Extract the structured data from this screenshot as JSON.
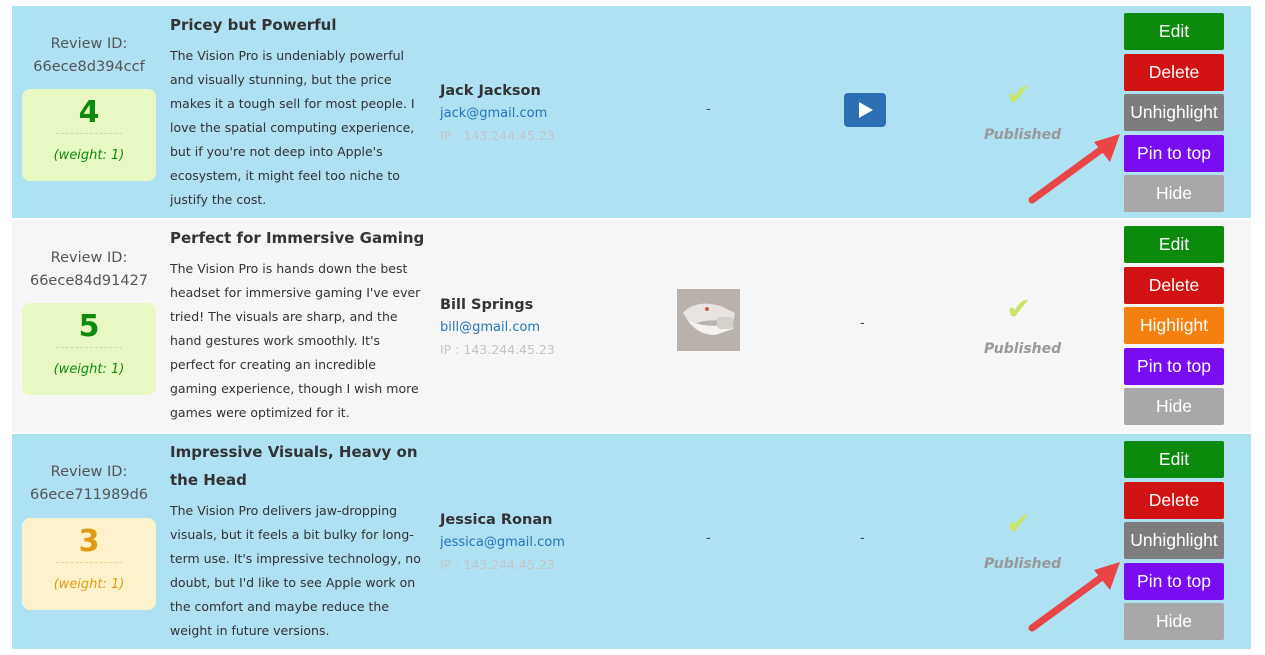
{
  "colors": {
    "highlight_row": "#aee1f2",
    "plain_row": "#f6f6f6",
    "edit": "#0b8a0b",
    "delete": "#d01212",
    "unhighlight": "#7d7d7d",
    "highlight": "#f5800f",
    "pin": "#7a0cf2",
    "hide": "#a8a8a8",
    "annotation_arrow": "#e94545"
  },
  "reviews": [
    {
      "id_label": "Review ID:",
      "id": "66ece8d394ccf",
      "score": "4",
      "weight": "(weight: 1)",
      "title": "Pricey but Powerful",
      "body": "The Vision Pro is undeniably powerful and visually stunning, but the price makes it a tough sell for most people. I love the spatial computing experience, but if you're not deep into Apple's ecosystem, it might feel too niche to justify the cost.",
      "author": "Jack Jackson",
      "email": "jack@gmail.com",
      "ip": "IP : 143.244.45.23",
      "media_placeholder": "-",
      "video_icon": "play-icon",
      "status_icon": "checkmark-icon",
      "status": "Published",
      "buttons": [
        "Edit",
        "Delete",
        "Unhighlight",
        "Pin to top",
        "Hide"
      ]
    },
    {
      "id_label": "Review ID:",
      "id": "66ece84d91427",
      "score": "5",
      "weight": "(weight: 1)",
      "title": "Perfect for Immersive Gaming",
      "body": "The Vision Pro is hands down the best headset for immersive gaming I've ever tried! The visuals are sharp, and the hand gestures work smoothly. It's perfect for creating an incredible gaming experience, though I wish more games were optimized for it.",
      "author": "Bill Springs",
      "email": "bill@gmail.com",
      "ip": "IP : 143.244.45.23",
      "media_placeholder": "-",
      "status_icon": "checkmark-icon",
      "status": "Published",
      "buttons": [
        "Edit",
        "Delete",
        "Highlight",
        "Pin to top",
        "Hide"
      ]
    },
    {
      "id_label": "Review ID:",
      "id": "66ece711989d6",
      "score": "3",
      "weight": "(weight: 1)",
      "title": "Impressive Visuals, Heavy on the Head",
      "body": "The Vision Pro delivers jaw-dropping visuals, but it feels a bit bulky for long-term use. It's impressive technology, no doubt, but I'd like to see Apple work on the comfort and maybe reduce the weight in future versions.",
      "author": "Jessica Ronan",
      "email": "jessica@gmail.com",
      "ip": "IP : 143.244.45.23",
      "media_placeholder": "-",
      "video_placeholder": "-",
      "status_icon": "checkmark-icon",
      "status": "Published",
      "buttons": [
        "Edit",
        "Delete",
        "Unhighlight",
        "Pin to top",
        "Hide"
      ]
    }
  ]
}
